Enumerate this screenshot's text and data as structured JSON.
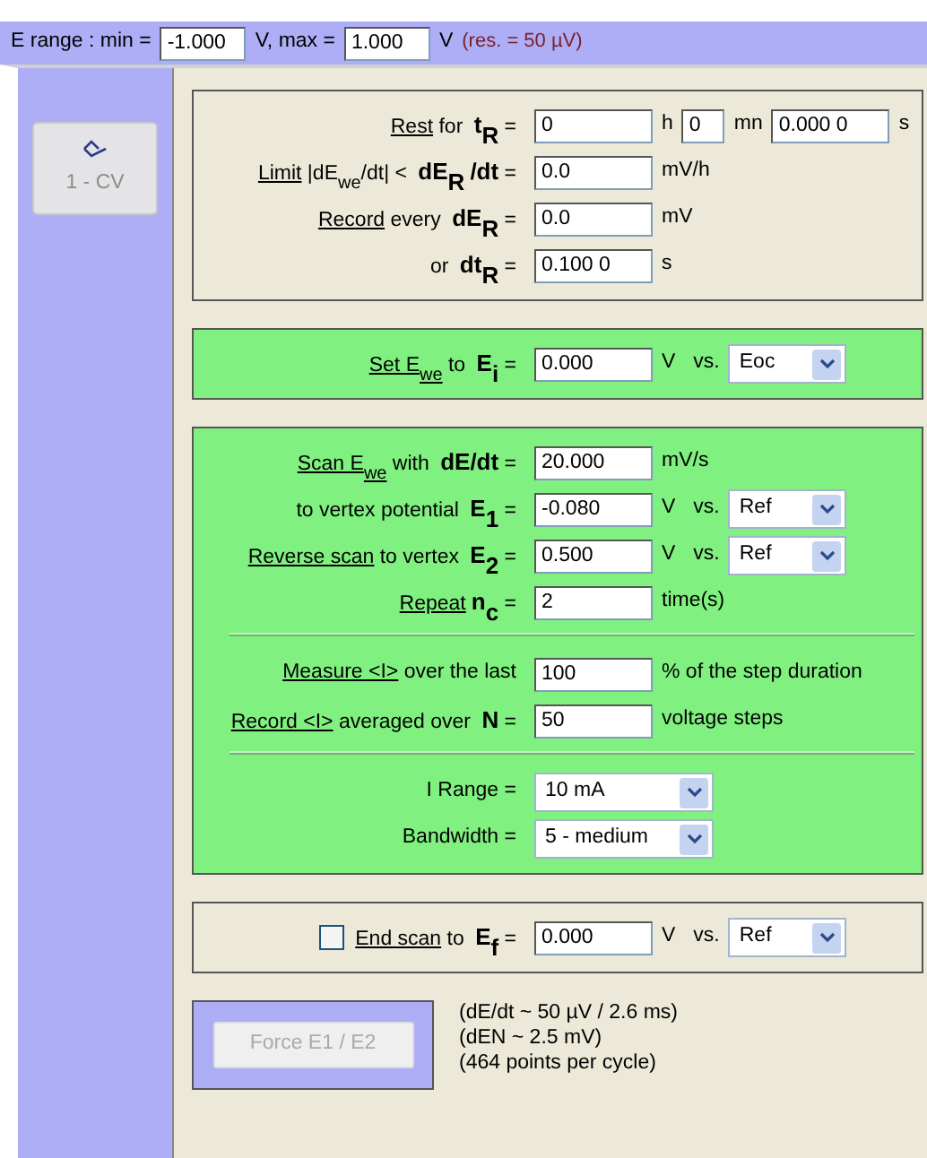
{
  "range_bar": {
    "label": "E range : min =",
    "min": "-1.000",
    "separator": "V, max =",
    "max": "1.000",
    "unit": "V",
    "resolution": "(res. = 50 µV)"
  },
  "sidebar": {
    "items": [
      {
        "label": "1 - CV",
        "disabled": true
      }
    ]
  },
  "sections": [
    {
      "kind": "plain",
      "rows": [
        {
          "kind": "row",
          "label": [
            {
              "t": "Rest",
              "kind": "underlined"
            },
            {
              "t": " for ",
              "kind": "plain"
            },
            {
              "t": "t",
              "kind": "bold"
            },
            {
              "t": "R",
              "kind": "boldsub"
            },
            {
              "t": " =",
              "kind": "plain"
            }
          ],
          "controls": [
            {
              "kind": "input",
              "value": "0"
            },
            {
              "kind": "unit",
              "text": "h"
            },
            {
              "kind": "mini",
              "value": "0"
            },
            {
              "kind": "unit",
              "text": "mn"
            },
            {
              "kind": "input",
              "value": "0.000 0"
            },
            {
              "kind": "unit",
              "text": "s"
            }
          ]
        },
        {
          "kind": "row",
          "label": [
            {
              "t": "Limit",
              "kind": "underlined"
            },
            {
              "t": " |dE",
              "kind": "plain"
            },
            {
              "t": "we",
              "kind": "sub"
            },
            {
              "t": "/dt| < ",
              "kind": "plain"
            },
            {
              "t": "dE",
              "kind": "bold"
            },
            {
              "t": "R",
              "kind": "boldsub"
            },
            {
              "t": "/dt",
              "kind": "bold"
            },
            {
              "t": " =",
              "kind": "plain"
            }
          ],
          "controls": [
            {
              "kind": "input",
              "value": "0.0"
            },
            {
              "kind": "unit",
              "text": "mV/h"
            }
          ]
        },
        {
          "kind": "row",
          "label": [
            {
              "t": "Record",
              "kind": "underlined"
            },
            {
              "t": " every ",
              "kind": "plain"
            },
            {
              "t": "dE",
              "kind": "bold"
            },
            {
              "t": "R",
              "kind": "boldsub"
            },
            {
              "t": " =",
              "kind": "plain"
            }
          ],
          "controls": [
            {
              "kind": "input",
              "value": "0.0"
            },
            {
              "kind": "unit",
              "text": "mV"
            }
          ]
        },
        {
          "kind": "row",
          "label": [
            {
              "t": "or ",
              "kind": "plain"
            },
            {
              "t": "dt",
              "kind": "bold"
            },
            {
              "t": "R",
              "kind": "boldsub"
            },
            {
              "t": " =",
              "kind": "plain"
            }
          ],
          "controls": [
            {
              "kind": "input",
              "value": "0.100 0"
            },
            {
              "kind": "unit",
              "text": "s"
            }
          ]
        }
      ]
    },
    {
      "kind": "highlighted",
      "rows": [
        {
          "kind": "row",
          "label": [
            {
              "t": "Set E",
              "kind": "underlined"
            },
            {
              "t": "we",
              "kind": "underlinedsub"
            },
            {
              "t": " to ",
              "kind": "plain"
            },
            {
              "t": "E",
              "kind": "bold"
            },
            {
              "t": "i",
              "kind": "boldsub"
            },
            {
              "t": " =",
              "kind": "plain"
            }
          ],
          "controls": [
            {
              "kind": "input",
              "value": "0.000"
            },
            {
              "kind": "unit",
              "text": "V"
            },
            {
              "kind": "unit",
              "text": "vs."
            },
            {
              "kind": "select",
              "value": "Eoc"
            }
          ]
        }
      ]
    },
    {
      "kind": "highlighted",
      "rows": [
        {
          "kind": "row",
          "label": [
            {
              "t": "Scan E",
              "kind": "underlined"
            },
            {
              "t": "we",
              "kind": "underlinedsub"
            },
            {
              "t": " with ",
              "kind": "plain"
            },
            {
              "t": "dE/dt",
              "kind": "bold"
            },
            {
              "t": " =",
              "kind": "plain"
            }
          ],
          "controls": [
            {
              "kind": "input",
              "value": "20.000"
            },
            {
              "kind": "unit",
              "text": "mV/s"
            }
          ]
        },
        {
          "kind": "row",
          "label": [
            {
              "t": "to vertex potential ",
              "kind": "plain"
            },
            {
              "t": "E",
              "kind": "bold"
            },
            {
              "t": "1",
              "kind": "boldsub"
            },
            {
              "t": " =",
              "kind": "plain"
            }
          ],
          "controls": [
            {
              "kind": "input",
              "value": "-0.080"
            },
            {
              "kind": "unit",
              "text": "V"
            },
            {
              "kind": "unit",
              "text": "vs."
            },
            {
              "kind": "select",
              "value": "Ref"
            }
          ]
        },
        {
          "kind": "row",
          "label": [
            {
              "t": "Reverse scan",
              "kind": "underlined"
            },
            {
              "t": " to vertex ",
              "kind": "plain"
            },
            {
              "t": "E",
              "kind": "bold"
            },
            {
              "t": "2",
              "kind": "boldsub"
            },
            {
              "t": " =",
              "kind": "plain"
            }
          ],
          "controls": [
            {
              "kind": "input",
              "value": "0.500"
            },
            {
              "kind": "unit",
              "text": "V"
            },
            {
              "kind": "unit",
              "text": "vs."
            },
            {
              "kind": "select",
              "value": "Ref"
            }
          ]
        },
        {
          "kind": "row",
          "label": [
            {
              "t": "Repeat",
              "kind": "underlined"
            },
            {
              "t": "n",
              "kind": "bold"
            },
            {
              "t": "c",
              "kind": "boldsub"
            },
            {
              "t": " =",
              "kind": "plain"
            }
          ],
          "controls": [
            {
              "kind": "input",
              "value": "2"
            },
            {
              "kind": "unit",
              "text": "time(s)"
            }
          ]
        },
        {
          "kind": "divider"
        },
        {
          "kind": "row",
          "label": [
            {
              "t": "Measure <I>",
              "kind": "underlined"
            },
            {
              "t": " over the last",
              "kind": "plain"
            }
          ],
          "controls": [
            {
              "kind": "input",
              "value": "100"
            },
            {
              "kind": "unit",
              "text": "% of the step duration"
            }
          ]
        },
        {
          "kind": "row",
          "label": [
            {
              "t": "Record <I>",
              "kind": "underlined"
            },
            {
              "t": " averaged over ",
              "kind": "plain"
            },
            {
              "t": "N",
              "kind": "bold"
            },
            {
              "t": " =",
              "kind": "plain"
            }
          ],
          "controls": [
            {
              "kind": "input",
              "value": "50"
            },
            {
              "kind": "unit",
              "text": "voltage steps"
            }
          ]
        },
        {
          "kind": "divider"
        },
        {
          "kind": "row",
          "label": [
            {
              "t": "I Range =",
              "kind": "plain"
            }
          ],
          "controls": [
            {
              "kind": "select",
              "value": "10 mA"
            }
          ]
        },
        {
          "kind": "row",
          "label": [
            {
              "t": "Bandwidth =",
              "kind": "plain"
            }
          ],
          "controls": [
            {
              "kind": "select",
              "value": "5 - medium"
            }
          ]
        }
      ]
    },
    {
      "kind": "plain",
      "rows": [
        {
          "kind": "row",
          "checkbox": {
            "checked": false
          },
          "label": [
            {
              "t": "End scan",
              "kind": "underlined"
            },
            {
              "t": " to  ",
              "kind": "plain"
            },
            {
              "t": "E",
              "kind": "bold"
            },
            {
              "t": "f",
              "kind": "boldsub"
            },
            {
              "t": " =",
              "kind": "plain"
            }
          ],
          "controls": [
            {
              "kind": "input",
              "value": "0.000"
            },
            {
              "kind": "unit",
              "text": "V"
            },
            {
              "kind": "unit",
              "text": "vs."
            },
            {
              "kind": "select",
              "value": "Ref"
            }
          ]
        }
      ]
    }
  ],
  "footer": {
    "button": {
      "label": "Force E1 / E2",
      "disabled": true
    },
    "notes": [
      "(dE/dt ~ 50 µV / 2.6 ms)",
      "(dEN ~ 2.5 mV)",
      "(464 points per cycle)"
    ]
  }
}
